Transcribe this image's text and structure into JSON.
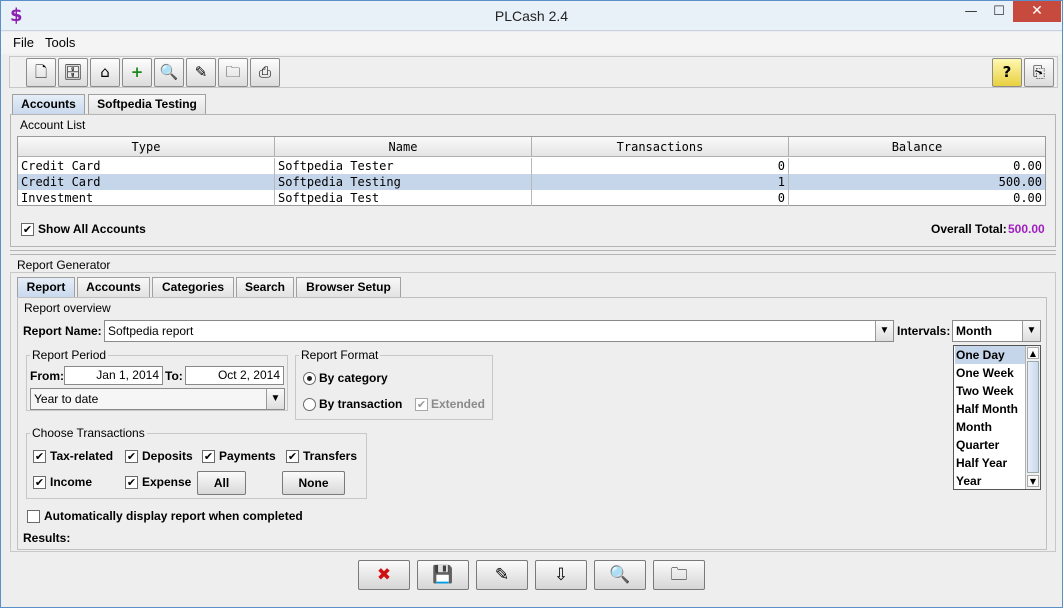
{
  "window": {
    "title": "PLCash 2.4",
    "app_icon": "$",
    "minimize": "—",
    "maximize": "☐",
    "close": "✕"
  },
  "menu": [
    "File",
    "Tools"
  ],
  "toolbar": {
    "left_icons": [
      "new-document-icon",
      "cabinet-icon",
      "home-icon",
      "add-icon",
      "search-icon",
      "edit-icon",
      "folder-icon",
      "print-icon"
    ],
    "left_glyphs": [
      "🗋",
      "🗄",
      "⌂",
      "+",
      "🔍",
      "✎",
      "🗀",
      "⎙"
    ],
    "right_icons": [
      "help-icon",
      "exit-icon"
    ],
    "right_glyphs": [
      "?",
      "⎘"
    ]
  },
  "top_tabs": [
    "Accounts",
    "Softpedia Testing"
  ],
  "account_list": {
    "title": "Account List",
    "columns": [
      "Type",
      "Name",
      "Transactions",
      "Balance"
    ],
    "rows": [
      [
        "Credit Card",
        "Softpedia Tester",
        "0",
        "0.00"
      ],
      [
        "Credit Card",
        "Softpedia Testing",
        "1",
        "500.00"
      ],
      [
        "Investment",
        "Softpedia Test",
        "0",
        "0.00"
      ]
    ],
    "selected_row": 1,
    "show_all_label": "Show All Accounts",
    "show_all_checked": "✔",
    "total_label": "Overall Total:",
    "total_value": "500.00",
    "total_color": "#a020c0"
  },
  "report": {
    "title": "Report Generator",
    "tabs": [
      "Report",
      "Accounts",
      "Categories",
      "Search",
      "Browser Setup"
    ],
    "overview_title": "Report overview",
    "name_label": "Report Name:",
    "name_value": "Softpedia report",
    "intervals_label": "Intervals:",
    "intervals_value": "Month",
    "intervals_options": [
      "One Day",
      "One Week",
      "Two Week",
      "Half Month",
      "Month",
      "Quarter",
      "Half Year",
      "Year"
    ],
    "intervals_highlighted": 0,
    "period_title": "Report Period",
    "from_label": "From:",
    "from_value": "Jan 1, 2014",
    "to_label": "To:",
    "to_value": "Oct 2, 2014",
    "period_preset": "Year to date",
    "format_title": "Report Format",
    "by_category": "By category",
    "by_transaction": "By transaction",
    "extended": "Extended",
    "choose_title": "Choose Transactions",
    "checkboxes": [
      "Tax-related",
      "Deposits",
      "Payments",
      "Transfers",
      "Income",
      "Expense"
    ],
    "check_mark": "✔",
    "all_btn": "All",
    "none_btn": "None",
    "auto_display": "Automatically display report when completed",
    "results_label": "Results:"
  },
  "bottom_buttons": {
    "icons": [
      "cancel-icon",
      "save-icon",
      "edit-icon",
      "export-icon",
      "preview-icon",
      "open-folder-icon"
    ],
    "glyphs": [
      "✖",
      "💾",
      "✎",
      "⇩",
      "🔍",
      "🗀"
    ]
  }
}
